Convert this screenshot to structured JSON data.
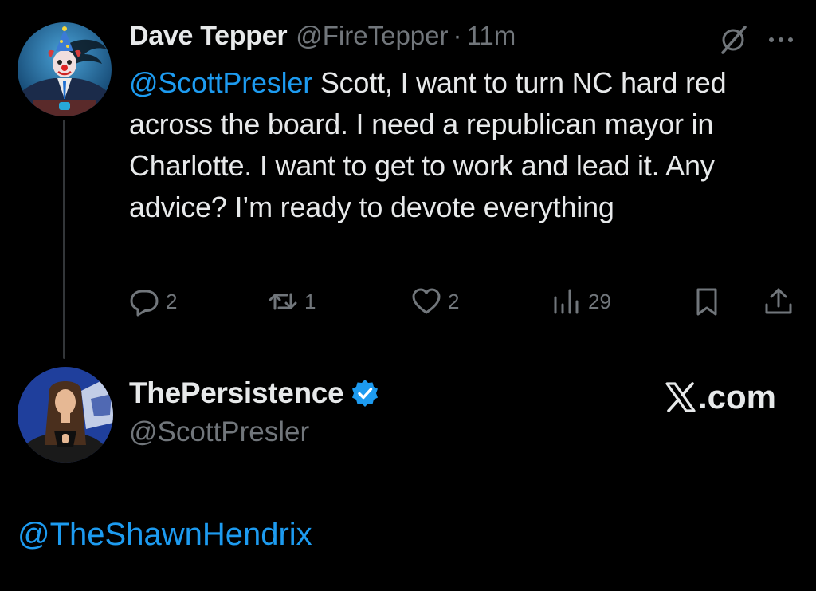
{
  "tweet": {
    "author_name": "Dave Tepper",
    "author_handle": "@FireTepper",
    "separator": "·",
    "time": "11m",
    "mention": "@ScottPresler",
    "text": " Scott, I want to turn NC hard red across the board. I need a republican mayor in Charlotte. I want to get to work and lead it. Any advice? I’m ready to devote everything",
    "actions": {
      "reply_count": "2",
      "retweet_count": "1",
      "like_count": "2",
      "views_count": "29"
    }
  },
  "reply_profile": {
    "name": "ThePersistence",
    "handle": "@ScottPresler",
    "verified": true
  },
  "watermark": {
    "text": ".com"
  },
  "bottom": {
    "mention": "@TheShawnHendrix"
  },
  "colors": {
    "background": "#000000",
    "text": "#e7e9ea",
    "muted": "#71767b",
    "accent": "#1d9bf0"
  },
  "icons": [
    "grok-icon",
    "more-icon",
    "reply-icon",
    "retweet-icon",
    "like-icon",
    "views-icon",
    "bookmark-icon",
    "share-icon",
    "verified-badge-icon",
    "x-logo-icon"
  ]
}
